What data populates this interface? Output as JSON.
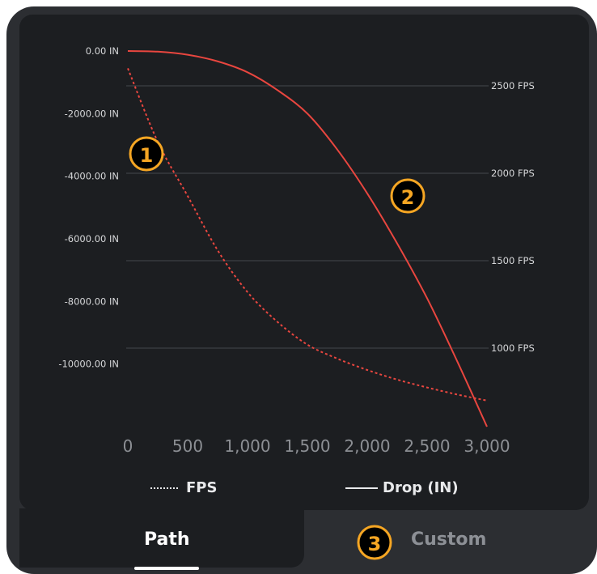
{
  "chart_data": {
    "type": "line",
    "x": [
      0,
      250,
      500,
      750,
      1000,
      1250,
      1500,
      1750,
      2000,
      2250,
      2500,
      2750,
      3000
    ],
    "xtick_labels": [
      "0",
      "500",
      "1,000",
      "1,500",
      "2,000",
      "2,500",
      "3,000"
    ],
    "xlim": [
      0,
      3000
    ],
    "y_left_ticks": [
      "0.00 IN",
      "-2000.00 IN",
      "-4000.00 IN",
      "-6000.00 IN",
      "-8000.00 IN",
      "-10000.00 IN"
    ],
    "y_left_lim": [
      -12000,
      0
    ],
    "y_right_ticks": [
      "2500 FPS",
      "2000 FPS",
      "1500 FPS",
      "1000 FPS"
    ],
    "y_right_lim": [
      575,
      2700
    ],
    "grid": true,
    "series": [
      {
        "name": "FPS",
        "axis": "right",
        "style": "dotted",
        "color": "#e8463f",
        "values": [
          2600,
          2180,
          1870,
          1560,
          1320,
          1150,
          1020,
          940,
          875,
          820,
          775,
          735,
          700
        ]
      },
      {
        "name": "Drop (IN)",
        "axis": "left",
        "style": "solid",
        "color": "#e8463f",
        "values": [
          0,
          -20,
          -120,
          -330,
          -680,
          -1250,
          -2000,
          -3150,
          -4550,
          -6150,
          -7900,
          -9900,
          -12000
        ]
      }
    ],
    "legend": [
      {
        "label": "FPS",
        "style": "dotted"
      },
      {
        "label": "Drop (IN)",
        "style": "solid"
      }
    ]
  },
  "badges": [
    "1",
    "2",
    "3"
  ],
  "tabs": {
    "path_label": "Path",
    "custom_label": "Custom"
  },
  "colors": {
    "accent": "#f6a623",
    "line": "#e8463f",
    "panel": "#1c1e21",
    "frame": "#2c2e32"
  }
}
